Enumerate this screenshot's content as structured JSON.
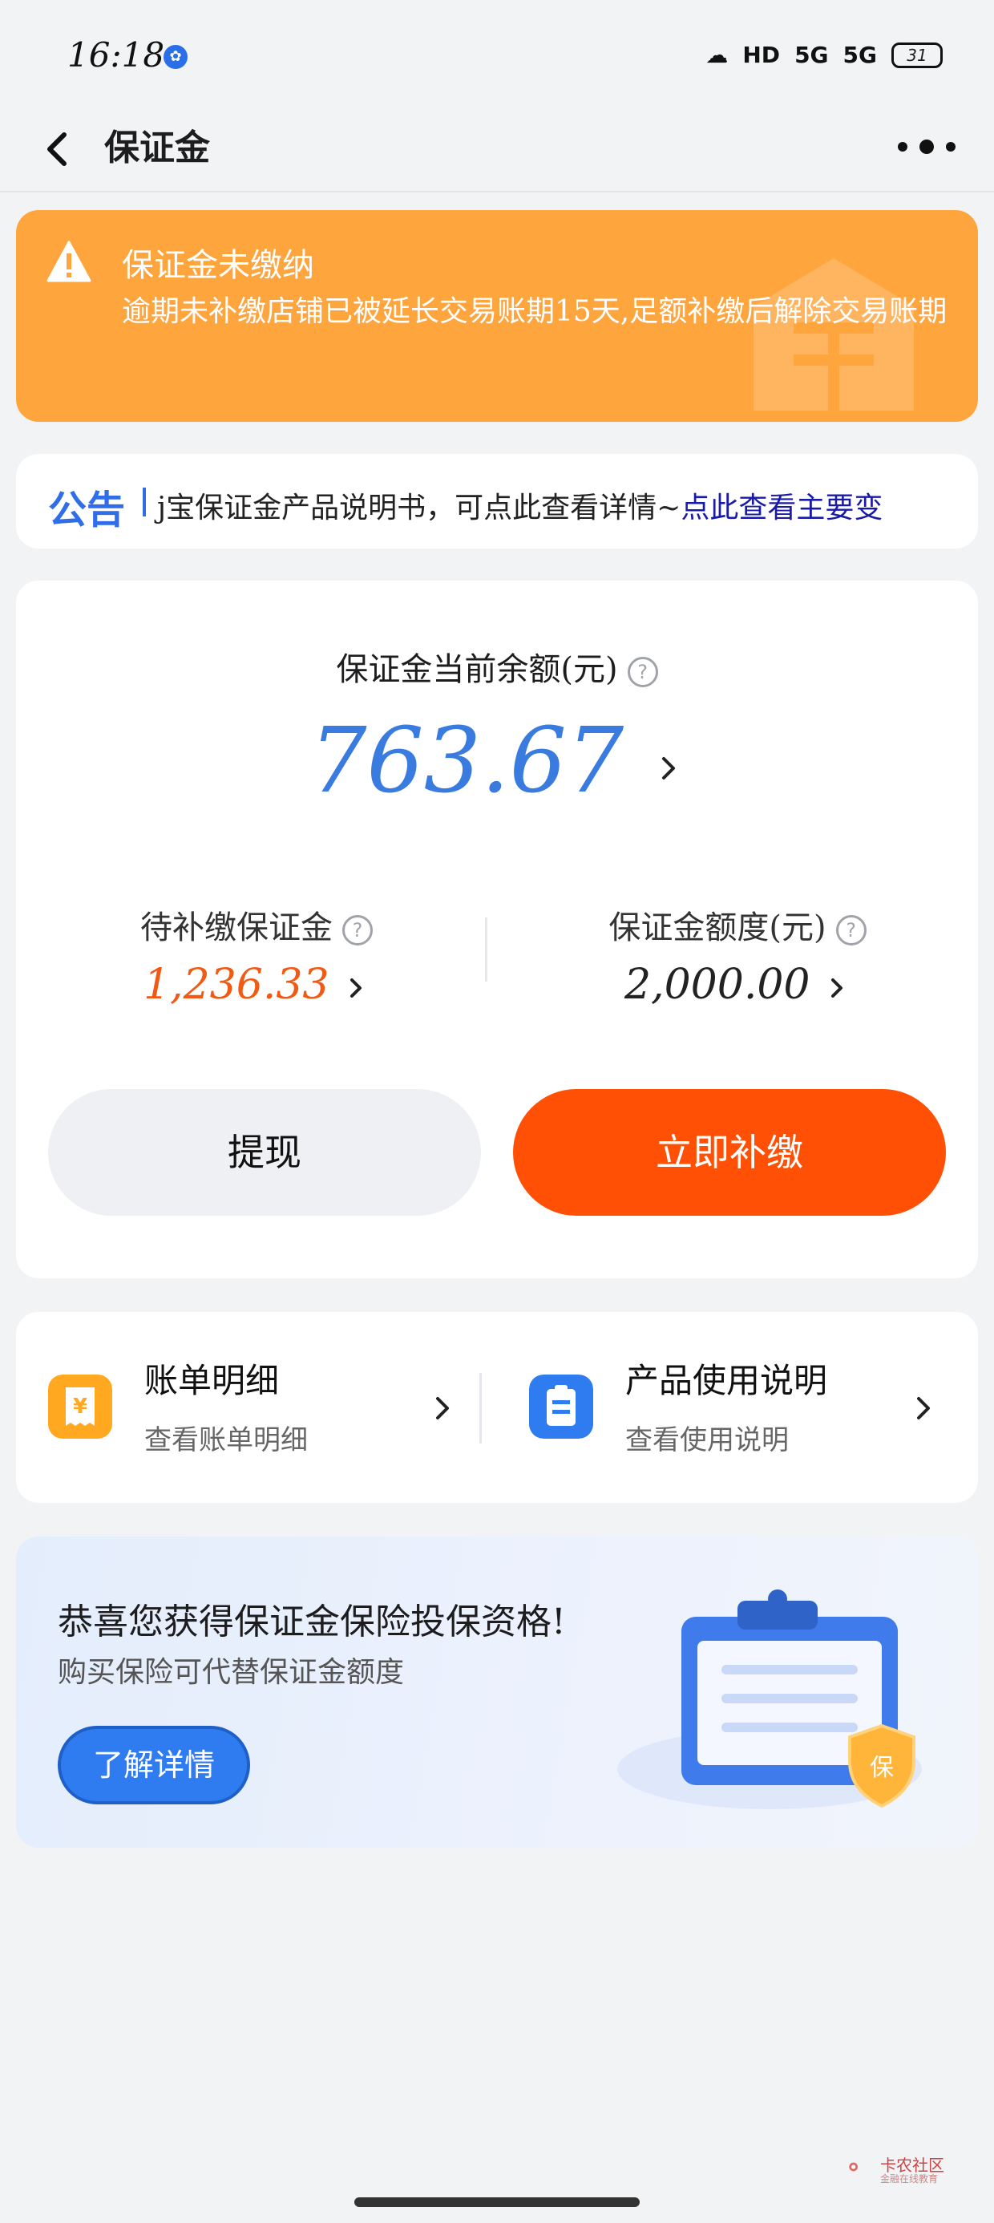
{
  "status_bar": {
    "time": "16:18",
    "battery": "31",
    "signal_1": "5G",
    "signal_2": "5G",
    "hd": "HD"
  },
  "nav": {
    "title": "保证金"
  },
  "warning": {
    "title": "保证金未缴纳",
    "description": "逾期未补缴店铺已被延长交易账期15天,足额补缴后解除交易账期",
    "color": "#ffa53d"
  },
  "notice": {
    "tag": "公告",
    "text": "j宝保证金产品说明书，可点此查看详情~",
    "link": "点此查看主要变"
  },
  "balance": {
    "label": "保证金当前余额(元)",
    "amount": "763.67",
    "pending_label": "待补缴保证金",
    "pending_value": "1,236.33",
    "quota_label": "保证金额度(元)",
    "quota_value": "2,000.00",
    "withdraw_label": "提现",
    "pay_label": "立即补缴",
    "accent_color": "#ff5006"
  },
  "entries": [
    {
      "title": "账单明细",
      "desc": "查看账单明细",
      "icon": "yen-receipt-icon"
    },
    {
      "title": "产品使用说明",
      "desc": "查看使用说明",
      "icon": "clipboard-icon"
    }
  ],
  "insurance": {
    "title": "恭喜您获得保证金保险投保资格!",
    "subtitle": "购买保险可代替保证金额度",
    "button": "了解详情",
    "badge": "保"
  },
  "watermark": {
    "text": "卡农社区",
    "sub": "金融在线教育"
  }
}
